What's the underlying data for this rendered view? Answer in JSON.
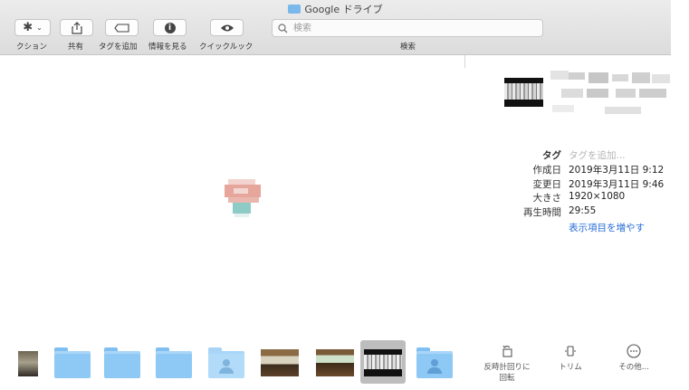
{
  "window": {
    "title": "Google ドライブ"
  },
  "toolbar": {
    "action_label": "クション",
    "share_label": "共有",
    "add_tag_label": "タグを追加",
    "info_label": "情報を見る",
    "quicklook_label": "クイックルック",
    "search_label": "検索",
    "search_placeholder": "検索"
  },
  "info_panel": {
    "rows": [
      {
        "key": "タグ",
        "value": "タグを追加..."
      },
      {
        "key": "作成日",
        "value": "2019年3月11日 9:12"
      },
      {
        "key": "変更日",
        "value": "2019年3月11日 9:46"
      },
      {
        "key": "大きさ",
        "value": "1920×1080"
      },
      {
        "key": "再生時間",
        "value": "29:55"
      }
    ],
    "show_more": "表示項目を増やす",
    "link_color": "#2a6fd6"
  },
  "actions": {
    "rotate_label": "反時計回りに回転",
    "trim_label": "トリム",
    "more_label": "その他..."
  }
}
